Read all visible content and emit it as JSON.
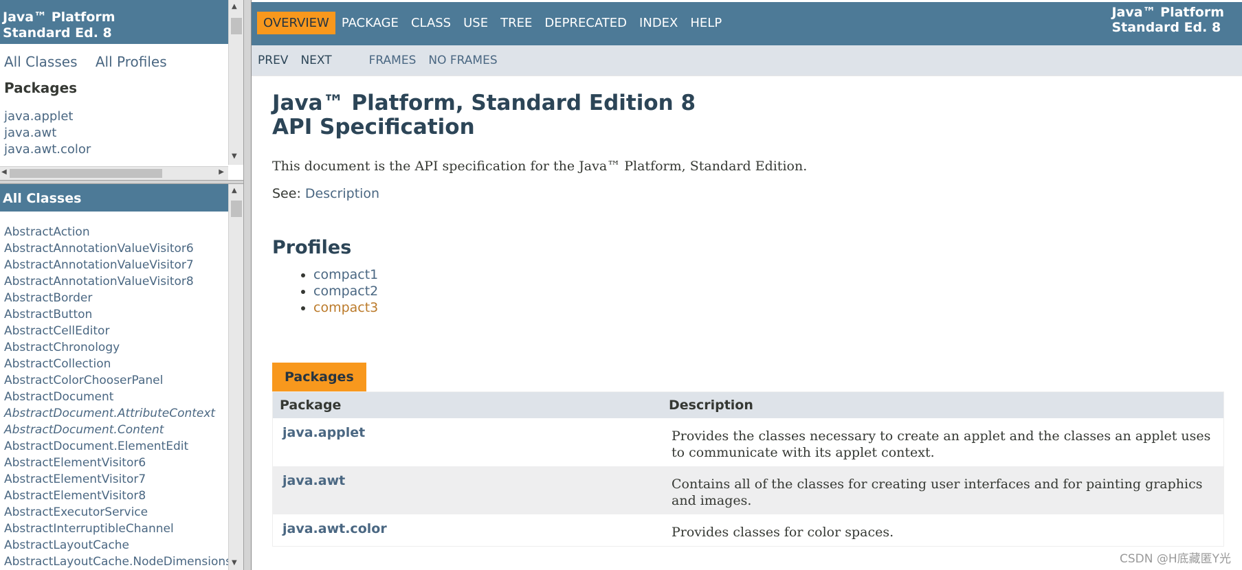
{
  "left_top": {
    "brand_line1": "Java™ Platform",
    "brand_line2": "Standard Ed. 8",
    "all_classes_link": "All Classes",
    "all_profiles_link": "All Profiles",
    "packages_title": "Packages",
    "packages": [
      "java.applet",
      "java.awt",
      "java.awt.color"
    ]
  },
  "left_bottom": {
    "title": "All Classes",
    "classes": [
      {
        "name": "AbstractAction",
        "italic": false
      },
      {
        "name": "AbstractAnnotationValueVisitor6",
        "italic": false
      },
      {
        "name": "AbstractAnnotationValueVisitor7",
        "italic": false
      },
      {
        "name": "AbstractAnnotationValueVisitor8",
        "italic": false
      },
      {
        "name": "AbstractBorder",
        "italic": false
      },
      {
        "name": "AbstractButton",
        "italic": false
      },
      {
        "name": "AbstractCellEditor",
        "italic": false
      },
      {
        "name": "AbstractChronology",
        "italic": false
      },
      {
        "name": "AbstractCollection",
        "italic": false
      },
      {
        "name": "AbstractColorChooserPanel",
        "italic": false
      },
      {
        "name": "AbstractDocument",
        "italic": false
      },
      {
        "name": "AbstractDocument.AttributeContext",
        "italic": true
      },
      {
        "name": "AbstractDocument.Content",
        "italic": true
      },
      {
        "name": "AbstractDocument.ElementEdit",
        "italic": false
      },
      {
        "name": "AbstractElementVisitor6",
        "italic": false
      },
      {
        "name": "AbstractElementVisitor7",
        "italic": false
      },
      {
        "name": "AbstractElementVisitor8",
        "italic": false
      },
      {
        "name": "AbstractExecutorService",
        "italic": false
      },
      {
        "name": "AbstractInterruptibleChannel",
        "italic": false
      },
      {
        "name": "AbstractLayoutCache",
        "italic": false
      },
      {
        "name": "AbstractLayoutCache.NodeDimensions",
        "italic": false
      }
    ]
  },
  "topnav": {
    "items": [
      "OVERVIEW",
      "PACKAGE",
      "CLASS",
      "USE",
      "TREE",
      "DEPRECATED",
      "INDEX",
      "HELP"
    ],
    "active": "OVERVIEW",
    "brand_line1": "Java™ Platform",
    "brand_line2": "Standard Ed. 8"
  },
  "subnav": {
    "prev": "PREV",
    "next": "NEXT",
    "frames": "FRAMES",
    "no_frames": "NO FRAMES"
  },
  "main": {
    "title_line1": "Java™ Platform, Standard Edition 8",
    "title_line2": "API Specification",
    "description": "This document is the API specification for the Java™ Platform, Standard Edition.",
    "see_label": "See:",
    "see_link": "Description",
    "profiles_heading": "Profiles",
    "profiles": [
      "compact1",
      "compact2",
      "compact3"
    ],
    "hovered_profile": "compact3",
    "packages_caption": "Packages",
    "table_headers": {
      "package": "Package",
      "description": "Description"
    },
    "table_rows": [
      {
        "name": "java.applet",
        "description": "Provides the classes necessary to create an applet and the classes an applet uses to communicate with its applet context."
      },
      {
        "name": "java.awt",
        "description": "Contains all of the classes for creating user interfaces and for painting graphics and images."
      },
      {
        "name": "java.awt.color",
        "description": "Provides classes for color spaces."
      }
    ]
  },
  "watermark": "CSDN @H底藏匿Y光",
  "colors": {
    "header_blue": "#4d7a97",
    "accent_orange": "#f8981d",
    "link_blue": "#4a6782",
    "subnav_gray": "#dee3e9"
  }
}
